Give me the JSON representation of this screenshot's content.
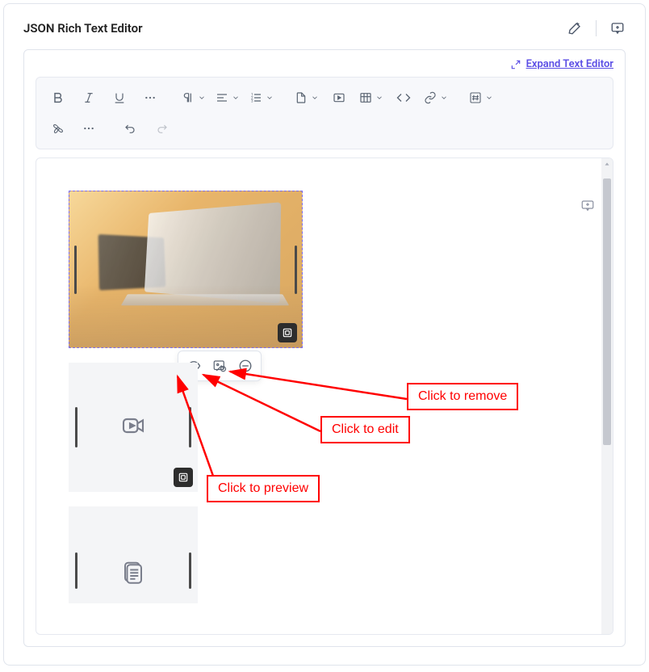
{
  "header": {
    "title": "JSON Rich Text Editor"
  },
  "editor": {
    "expand_link": "Expand Text Editor"
  },
  "floating_toolbar": {
    "preview": "preview",
    "edit": "edit",
    "remove": "remove"
  },
  "callouts": {
    "remove": "Click to remove",
    "edit": "Click to edit",
    "preview": "Click to preview"
  }
}
